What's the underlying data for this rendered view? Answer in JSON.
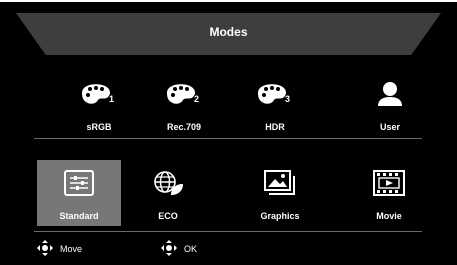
{
  "header": {
    "title": "Modes"
  },
  "modes_row1": [
    {
      "label": "sRGB",
      "sub": "1",
      "icon": "palette-icon"
    },
    {
      "label": "Rec.709",
      "sub": "2",
      "icon": "palette-icon"
    },
    {
      "label": "HDR",
      "sub": "3",
      "icon": "palette-icon"
    },
    {
      "label": "User",
      "icon": "user-icon"
    }
  ],
  "modes_row2": [
    {
      "label": "Standard",
      "icon": "sliders-icon",
      "selected": true
    },
    {
      "label": "ECO",
      "icon": "globe-leaf-icon"
    },
    {
      "label": "Graphics",
      "icon": "image-icon"
    },
    {
      "label": "Movie",
      "icon": "film-icon"
    }
  ],
  "footer": {
    "move_label": "Move",
    "ok_label": "OK"
  },
  "colors": {
    "background": "#000000",
    "header": "#3e3e3e",
    "selected": "#777777",
    "text": "#ffffff"
  }
}
